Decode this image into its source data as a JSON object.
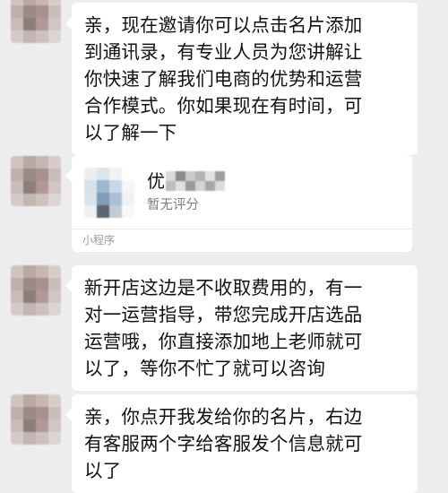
{
  "messages": [
    {
      "type": "text",
      "lines": [
        "亲，现在邀请你可以点击名片添加",
        "到通讯录，有专业人员为您讲解让",
        "你快速了解我们电商的优势和运营",
        "合作模式。你如果现在有时间，可",
        "以了解一下"
      ]
    },
    {
      "type": "mini_program_card",
      "name": "优",
      "rating": "暂无评分",
      "tag": "小程序"
    },
    {
      "type": "text",
      "lines": [
        "新开店这边是不收取费用的，有一",
        "对一运营指导，带您完成开店选品",
        "运营哦，你直接添加地上老师就可",
        "以了，等你不忙了就可以咨询"
      ]
    },
    {
      "type": "text",
      "lines": [
        "亲，你点开我发给你的名片，右边",
        "有客服两个字给客服发个信息就可",
        "以了"
      ]
    }
  ],
  "colors": {
    "background": "#ededed",
    "bubble": "#ffffff",
    "text": "#111111",
    "secondary_text": "#7f7f7f"
  }
}
